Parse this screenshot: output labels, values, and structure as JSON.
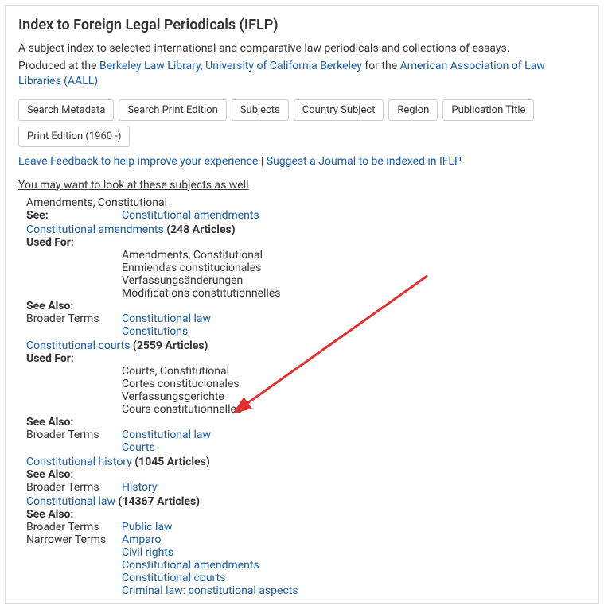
{
  "header": {
    "title": "Index to Foreign Legal Periodicals (IFLP)",
    "intro_prefix": "A subject index to selected international and comparative law periodicals and collections of essays.",
    "produced_at_prefix": "Produced at the ",
    "berkeley_link": "Berkeley Law Library, University of California Berkeley",
    "for_text": " for the ",
    "aall_link": "American Association of Law Libraries (AALL)"
  },
  "tabs": [
    "Search Metadata",
    "Search Print Edition",
    "Subjects",
    "Country Subject",
    "Region",
    "Publication Title",
    "Print Edition (1960 -)"
  ],
  "feedback": {
    "leave": "Leave Feedback to help improve your experience",
    "sep": " | ",
    "suggest": "Suggest a Journal to be indexed in IFLP"
  },
  "hint": "You may want to look at these subjects as well",
  "labels": {
    "see": "See:",
    "used_for": "Used For:",
    "see_also": "See Also:",
    "broader": "Broader Terms",
    "narrower": "Narrower Terms"
  },
  "entries": [
    {
      "title_plain": "Amendments, Constitutional",
      "see": "Constitutional amendments"
    },
    {
      "title_link": "Constitutional amendments",
      "count": " (248 Articles)",
      "used_for": [
        "Amendments, Constitutional",
        "Enmiendas constitucionales",
        "Verfassungsänderungen",
        "Modifications constitutionnelles"
      ],
      "broader": [
        "Constitutional law",
        "Constitutions"
      ]
    },
    {
      "title_link": "Constitutional courts",
      "count": " (2559 Articles)",
      "used_for": [
        "Courts, Constitutional",
        "Cortes constitucionales",
        "Verfassungsgerichte",
        "Cours constitutionnelles"
      ],
      "broader": [
        "Constitutional law",
        "Courts"
      ]
    },
    {
      "title_link": "Constitutional history",
      "count": " (1045 Articles)",
      "broader": [
        "History"
      ]
    },
    {
      "title_link": "Constitutional law",
      "count": " (14367 Articles)",
      "broader": [
        "Public law"
      ],
      "narrower": [
        "Amparo",
        "Civil rights",
        "Constitutional amendments",
        "Constitutional courts",
        "Criminal law: constitutional aspects"
      ]
    }
  ]
}
